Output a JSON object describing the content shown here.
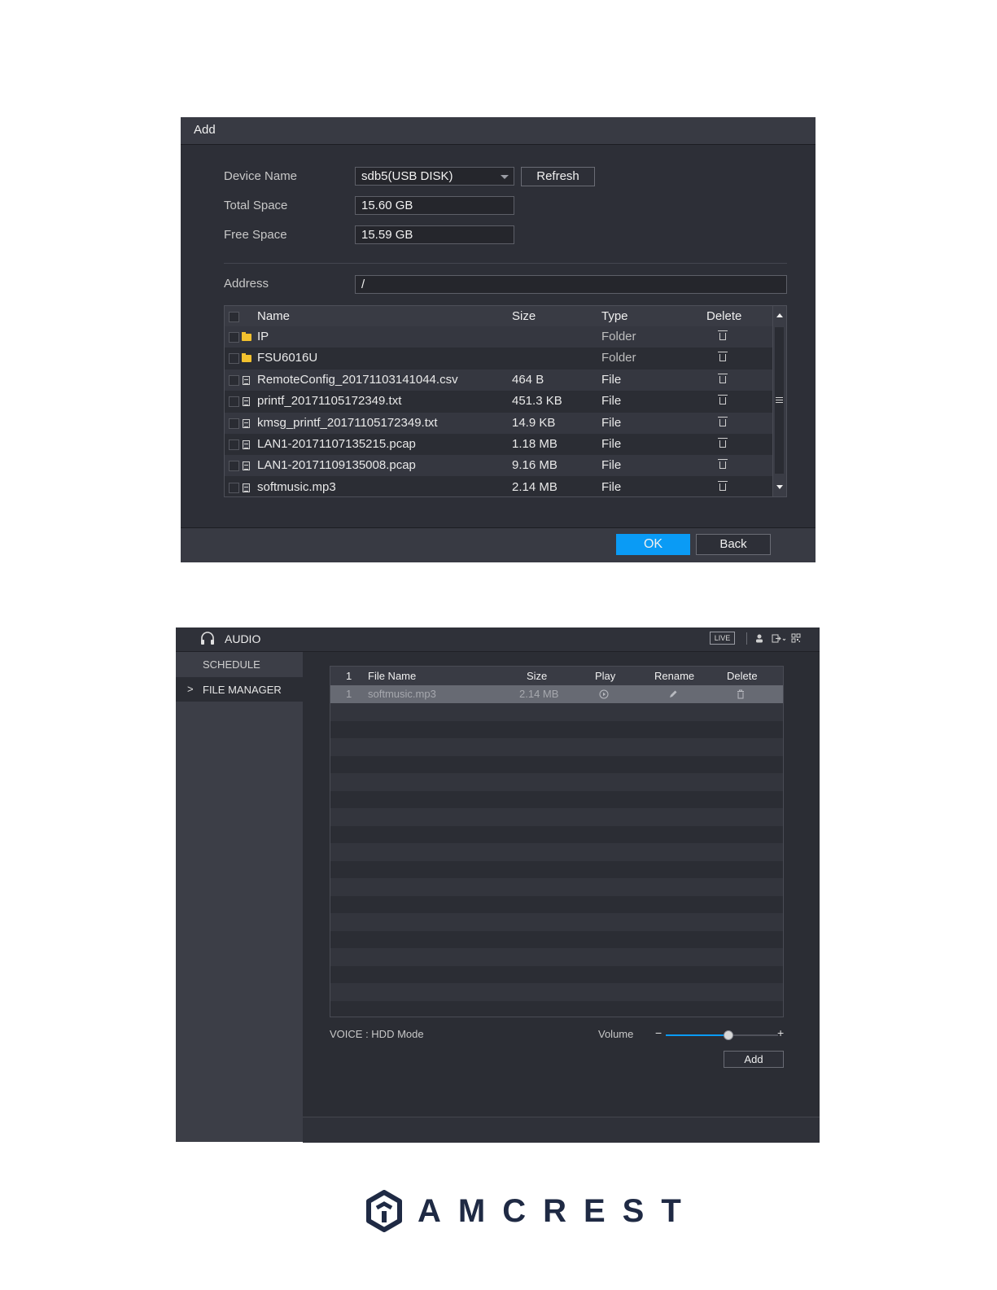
{
  "add_dialog": {
    "title": "Add",
    "device_name_label": "Device Name",
    "device_name_value": "sdb5(USB DISK)",
    "refresh_label": "Refresh",
    "total_space_label": "Total Space",
    "total_space_value": "15.60 GB",
    "free_space_label": "Free Space",
    "free_space_value": "15.59 GB",
    "address_label": "Address",
    "address_value": "/",
    "columns": {
      "name": "Name",
      "size": "Size",
      "type": "Type",
      "delete": "Delete"
    },
    "rows": [
      {
        "icon": "folder-icon",
        "name": "IP",
        "size": "",
        "type": "Folder"
      },
      {
        "icon": "folder-icon",
        "name": "FSU6016U",
        "size": "",
        "type": "Folder"
      },
      {
        "icon": "file-icon",
        "name": "RemoteConfig_20171103141044.csv",
        "size": "464 B",
        "type": "File"
      },
      {
        "icon": "file-icon",
        "name": "printf_20171105172349.txt",
        "size": "451.3 KB",
        "type": "File"
      },
      {
        "icon": "file-icon",
        "name": "kmsg_printf_20171105172349.txt",
        "size": "14.9 KB",
        "type": "File"
      },
      {
        "icon": "file-icon",
        "name": "LAN1-20171107135215.pcap",
        "size": "1.18 MB",
        "type": "File"
      },
      {
        "icon": "file-icon",
        "name": "LAN1-20171109135008.pcap",
        "size": "9.16 MB",
        "type": "File"
      },
      {
        "icon": "file-icon",
        "name": "softmusic.mp3",
        "size": "2.14 MB",
        "type": "File"
      }
    ],
    "ok_label": "OK",
    "back_label": "Back",
    "accent_color": "#0a9bf5"
  },
  "audio_window": {
    "title": "AUDIO",
    "live_badge": "LIVE",
    "sidebar": [
      {
        "label": "SCHEDULE",
        "active": false
      },
      {
        "label": "FILE MANAGER",
        "active": true
      }
    ],
    "active_marker": ">",
    "columns": {
      "index": "1",
      "file_name": "File Name",
      "size": "Size",
      "play": "Play",
      "rename": "Rename",
      "delete": "Delete"
    },
    "rows": [
      {
        "index": "1",
        "file_name": "softmusic.mp3",
        "size": "2.14 MB"
      }
    ],
    "voice_label": "VOICE : HDD Mode",
    "volume_label": "Volume",
    "volume_minus": "−",
    "volume_plus": "+",
    "volume_level_percent": 56,
    "add_label": "Add"
  },
  "logo": {
    "text": "AMCREST",
    "color": "#1f2a44"
  }
}
